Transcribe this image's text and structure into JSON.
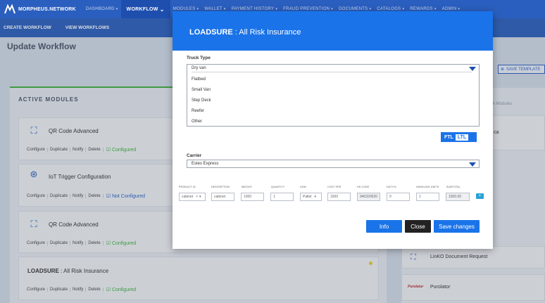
{
  "app": {
    "brand": "MORPHEUS.NETWORK"
  },
  "nav": {
    "items": [
      {
        "label": "DASHBOARD",
        "active": false
      },
      {
        "label": "WORKFLOW",
        "active": true
      },
      {
        "label": "MODULES",
        "active": false
      },
      {
        "label": "WALLET",
        "active": false
      },
      {
        "label": "PAYMENT HISTORY",
        "active": false
      },
      {
        "label": "FRAUD PREVENTION",
        "active": false
      },
      {
        "label": "DOCUMENTS",
        "active": false
      },
      {
        "label": "CATALOGS",
        "active": false
      },
      {
        "label": "REWARDS",
        "active": false
      },
      {
        "label": "ADMIN",
        "active": false
      }
    ]
  },
  "subnav": {
    "create": "CREATE WORKFLOW",
    "view": "VIEW WORKFLOWS"
  },
  "page": {
    "title": "Update Workflow",
    "save_template": "SAVE TEMPLATE",
    "search_placeholder": "earch Modules"
  },
  "active_modules": {
    "title": "ACTIVE MODULES",
    "actions": [
      "Configure",
      "Duplicate",
      "Notify",
      "Delete"
    ],
    "modules": [
      {
        "name": "QR Code Advanced",
        "status": "Configured",
        "icon": "qr-scan-icon"
      },
      {
        "name": "IoT Trigger Configuration",
        "status": "Not Configured",
        "icon": "iot-icon"
      },
      {
        "name": "QR Code Advanced",
        "status": "Configured",
        "icon": "qr-scan-icon"
      },
      {
        "name_bold": "LOADSURE",
        "name_rest": " : All Risk Insurance",
        "status": "Configured"
      }
    ]
  },
  "right_panel": {
    "cards": [
      {
        "text": "ca"
      },
      {
        "text": "LinKO Document Request"
      },
      {
        "text": "Purolator"
      }
    ]
  },
  "modal": {
    "title_bold": "LOADSURE",
    "title_rest": " : All Risk Insurance",
    "truck_type_label": "Truck Type",
    "truck_types": [
      "Dry van",
      "Flatbed",
      "Small Van",
      "Step Deck",
      "Reefer",
      "Other"
    ],
    "selected_truck_type": "Dry van",
    "mode": {
      "ftl": "FTL",
      "ltl": "LTL"
    },
    "carrier_label": "Carrier",
    "carrier_value": "Estes Express",
    "grid": {
      "headers": [
        "PRODUCT ID",
        "DESCRIPTION",
        "WEIGHT",
        "QUANTITY",
        "UOM",
        "COST PER",
        "HS CODE",
        "DUTY%",
        "HANDLING UNITS",
        "SUBTOTAL"
      ],
      "row": {
        "product_id": "cabinet",
        "description": "cabinet",
        "weight": "1000",
        "quantity": "1",
        "uom": "Pallet",
        "cost_per": "1500",
        "hs_code": "940320020",
        "duty": "0",
        "handling_units": "1",
        "subtotal": "1500.00"
      },
      "add_label": "+"
    },
    "buttons": {
      "info": "Info",
      "close": "Close",
      "save": "Save changes"
    }
  }
}
